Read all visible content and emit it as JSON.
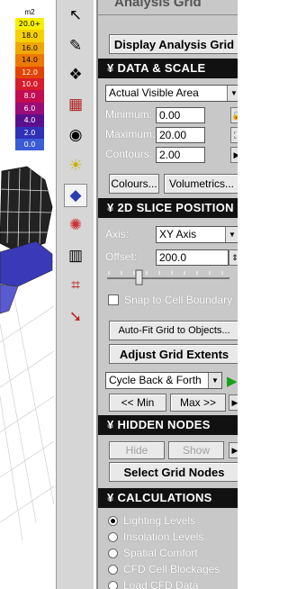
{
  "legend": {
    "unit": "m2",
    "rows": [
      {
        "label": "20.0+",
        "color": "#f7f000",
        "text_color": "#000000"
      },
      {
        "label": "18.0",
        "color": "#f6d000",
        "text_color": "#000000"
      },
      {
        "label": "16.0",
        "color": "#f0a800",
        "text_color": "#000000"
      },
      {
        "label": "14.0",
        "color": "#ec7a00",
        "text_color": "#000000"
      },
      {
        "label": "12.0",
        "color": "#e24400",
        "text_color": "#ffffff"
      },
      {
        "label": "10.0",
        "color": "#d81c2c",
        "text_color": "#ffffff"
      },
      {
        "label": "8.0",
        "color": "#c40c52",
        "text_color": "#ffffff"
      },
      {
        "label": "6.0",
        "color": "#9a0c78",
        "text_color": "#ffffff"
      },
      {
        "label": "4.0",
        "color": "#5a108e",
        "text_color": "#ffffff"
      },
      {
        "label": "2.0",
        "color": "#3030b8",
        "text_color": "#ffffff"
      },
      {
        "label": "0.0",
        "color": "#3a5cd6",
        "text_color": "#ffffff"
      }
    ]
  },
  "toolbar": {
    "tools": [
      {
        "name": "select-arrow-icon",
        "glyph": "↖"
      },
      {
        "name": "edit-pencil-icon",
        "glyph": "✎"
      },
      {
        "name": "nodes-diamond-icon",
        "glyph": "❖"
      },
      {
        "name": "red-grid-icon",
        "glyph": "▦"
      },
      {
        "name": "eye-icon",
        "glyph": "◉"
      },
      {
        "name": "sun-icon",
        "glyph": "☀"
      },
      {
        "name": "blue-grid-icon",
        "glyph": "◆"
      },
      {
        "name": "particles-icon",
        "glyph": "✺"
      },
      {
        "name": "bin-icon",
        "glyph": "▥"
      },
      {
        "name": "mesh-icon",
        "glyph": "⌗"
      },
      {
        "name": "export-icon",
        "glyph": "➘"
      }
    ]
  },
  "panel": {
    "title": "Analysis Grid",
    "display_button": "Display Analysis Grid",
    "data_scale": {
      "header": "DATA & SCALE",
      "mode_value": "Actual Visible Area",
      "minimum_label": "Minimum:",
      "minimum_value": "0.00",
      "maximum_label": "Maximum:",
      "maximum_value": "20.00",
      "contours_label": "Contours:",
      "contours_value": "2.00",
      "colours_button": "Colours...",
      "volumetrics_button": "Volumetrics..."
    },
    "slice": {
      "header": "2D SLICE POSITION",
      "axis_label": "Axis:",
      "axis_value": "XY Axis",
      "offset_label": "Offset:",
      "offset_value": "200.0",
      "snap_label": "Snap to Cell Boundary"
    },
    "auto_fit_button": "Auto-Fit Grid to Objects...",
    "adjust_button": "Adjust Grid Extents",
    "cycle": {
      "value": "Cycle Back & Forth",
      "min_button": "<< Min",
      "max_button": "Max >>"
    },
    "hidden_nodes": {
      "header": "HIDDEN NODES",
      "hide_button": "Hide",
      "show_button": "Show",
      "select_button": "Select Grid Nodes"
    },
    "calculations": {
      "header": "CALCULATIONS",
      "options": [
        {
          "label": "Lighting Levels",
          "selected": true
        },
        {
          "label": "Insolation Levels",
          "selected": false
        },
        {
          "label": "Spatial Comfort",
          "selected": false
        },
        {
          "label": "CFD Cell Blockages",
          "selected": false
        },
        {
          "label": "Load CFD Data",
          "selected": false
        }
      ]
    }
  }
}
